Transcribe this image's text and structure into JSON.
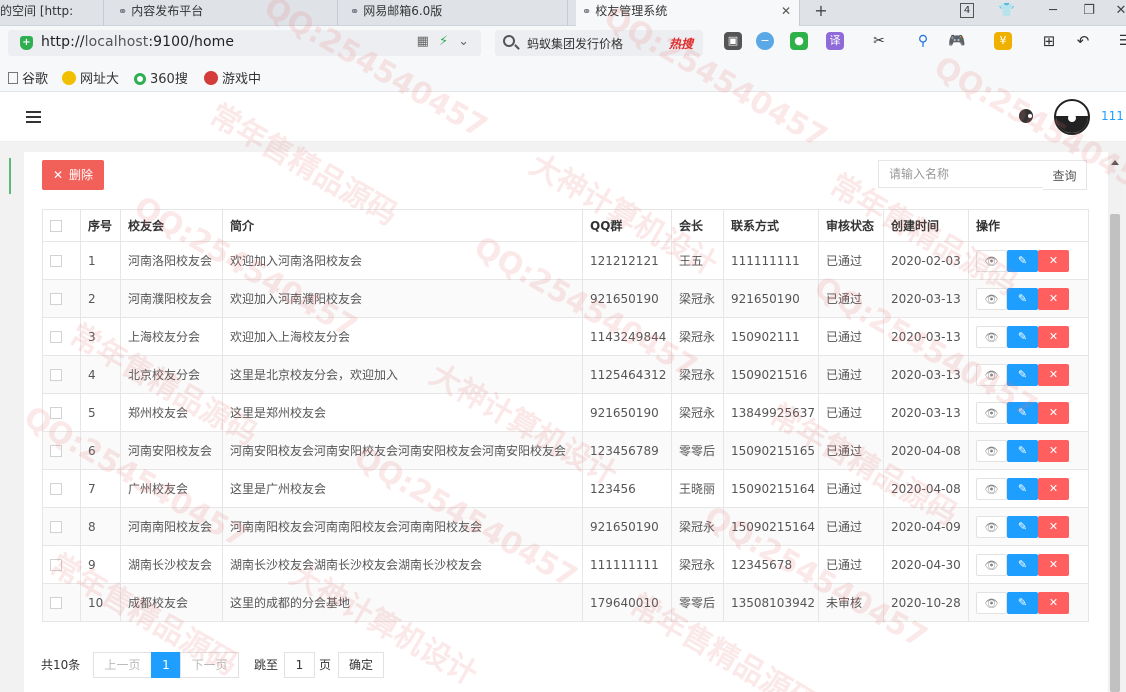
{
  "browser": {
    "tabs": [
      {
        "title": "的空间 [http:",
        "active": false
      },
      {
        "title": "内容发布平台",
        "active": false
      },
      {
        "title": "网易邮箱6.0版",
        "active": false
      },
      {
        "title": "校友管理系统",
        "active": true
      }
    ],
    "tab_count": "4",
    "url": {
      "prefix": "http://",
      "host": "localhost",
      "rest": ":9100/home"
    },
    "search_text": "蚂蚁集团发行价格",
    "hot_label": "热搜",
    "bookmarks": [
      "谷歌",
      "网址大",
      "360搜",
      "游戏中"
    ]
  },
  "header": {
    "username": "111"
  },
  "toolbar": {
    "delete_label": "删除",
    "search_placeholder": "请输入名称",
    "search_button": "查询"
  },
  "table": {
    "columns": [
      "序号",
      "校友会",
      "简介",
      "QQ群",
      "会长",
      "联系方式",
      "审核状态",
      "创建时间",
      "操作"
    ],
    "rows": [
      {
        "no": "1",
        "name": "河南洛阳校友会",
        "intro": "欢迎加入河南洛阳校友会",
        "qq": "121212121",
        "leader": "王五",
        "contact": "111111111",
        "status": "已通过",
        "created": "2020-02-03"
      },
      {
        "no": "2",
        "name": "河南濮阳校友会",
        "intro": "欢迎加入河南濮阳校友会",
        "qq": "921650190",
        "leader": "梁冠永",
        "contact": "921650190",
        "status": "已通过",
        "created": "2020-03-13"
      },
      {
        "no": "3",
        "name": "上海校友分会",
        "intro": "欢迎加入上海校友分会",
        "qq": "1143249844",
        "leader": "梁冠永",
        "contact": "150902111",
        "status": "已通过",
        "created": "2020-03-13"
      },
      {
        "no": "4",
        "name": "北京校友分会",
        "intro": "这里是北京校友分会，欢迎加入",
        "qq": "1125464312",
        "leader": "梁冠永",
        "contact": "1509021516",
        "status": "已通过",
        "created": "2020-03-13"
      },
      {
        "no": "5",
        "name": "郑州校友会",
        "intro": "这里是郑州校友会",
        "qq": "921650190",
        "leader": "梁冠永",
        "contact": "13849925637",
        "status": "已通过",
        "created": "2020-03-13"
      },
      {
        "no": "6",
        "name": "河南安阳校友会",
        "intro": "河南安阳校友会河南安阳校友会河南安阳校友会河南安阳校友会",
        "qq": "123456789",
        "leader": "零零后",
        "contact": "15090215165",
        "status": "已通过",
        "created": "2020-04-08"
      },
      {
        "no": "7",
        "name": "广州校友会",
        "intro": "这里是广州校友会",
        "qq": "123456",
        "leader": "王晓丽",
        "contact": "15090215164",
        "status": "已通过",
        "created": "2020-04-08"
      },
      {
        "no": "8",
        "name": "河南南阳校友会",
        "intro": "河南南阳校友会河南南阳校友会河南南阳校友会",
        "qq": "921650190",
        "leader": "梁冠永",
        "contact": "15090215164",
        "status": "已通过",
        "created": "2020-04-09"
      },
      {
        "no": "9",
        "name": "湖南长沙校友会",
        "intro": "湖南长沙校友会湖南长沙校友会湖南长沙校友会",
        "qq": "111111111",
        "leader": "梁冠永",
        "contact": "12345678",
        "status": "已通过",
        "created": "2020-04-30"
      },
      {
        "no": "10",
        "name": "成都校友会",
        "intro": "这里的成都的分会基地",
        "qq": "179640010",
        "leader": "零零后",
        "contact": "13508103942",
        "status": "未审核",
        "created": "2020-10-28"
      }
    ]
  },
  "pager": {
    "total": "共10条",
    "prev": "上一页",
    "current": "1",
    "next": "下一页",
    "goto": "跳至",
    "page_value": "1",
    "page_unit": "页",
    "confirm": "确定"
  },
  "watermarks": [
    "QQ:254540457",
    "常年售精品源码",
    "大神计算机设计"
  ]
}
